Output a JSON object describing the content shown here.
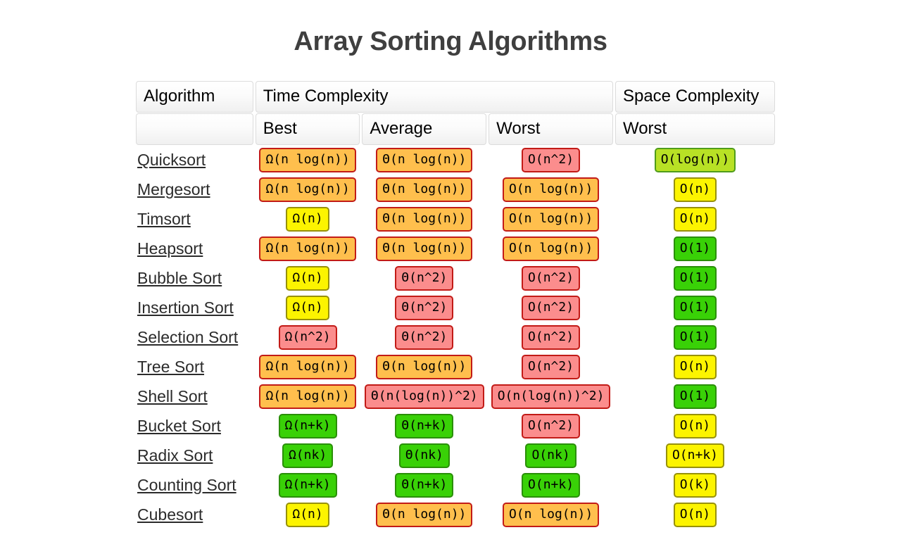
{
  "title": "Array Sorting Algorithms",
  "table": {
    "group_headers": [
      {
        "label": "Algorithm",
        "span": 1
      },
      {
        "label": "Time Complexity",
        "span": 3
      },
      {
        "label": "Space Complexity",
        "span": 1
      }
    ],
    "sub_headers": [
      "",
      "Best",
      "Average",
      "Worst",
      "Worst"
    ],
    "rows": [
      {
        "algorithm": "Quicksort",
        "best": {
          "text": "Ω(n log(n))",
          "rating": "bad"
        },
        "average": {
          "text": "Θ(n log(n))",
          "rating": "bad"
        },
        "worst": {
          "text": "O(n^2)",
          "rating": "horrible"
        },
        "space": {
          "text": "O(log(n))",
          "rating": "good"
        }
      },
      {
        "algorithm": "Mergesort",
        "best": {
          "text": "Ω(n log(n))",
          "rating": "bad"
        },
        "average": {
          "text": "Θ(n log(n))",
          "rating": "bad"
        },
        "worst": {
          "text": "O(n log(n))",
          "rating": "bad"
        },
        "space": {
          "text": "O(n)",
          "rating": "fair"
        }
      },
      {
        "algorithm": "Timsort",
        "best": {
          "text": "Ω(n)",
          "rating": "fair"
        },
        "average": {
          "text": "Θ(n log(n))",
          "rating": "bad"
        },
        "worst": {
          "text": "O(n log(n))",
          "rating": "bad"
        },
        "space": {
          "text": "O(n)",
          "rating": "fair"
        }
      },
      {
        "algorithm": "Heapsort",
        "best": {
          "text": "Ω(n log(n))",
          "rating": "bad"
        },
        "average": {
          "text": "Θ(n log(n))",
          "rating": "bad"
        },
        "worst": {
          "text": "O(n log(n))",
          "rating": "bad"
        },
        "space": {
          "text": "O(1)",
          "rating": "excellent"
        }
      },
      {
        "algorithm": "Bubble Sort",
        "best": {
          "text": "Ω(n)",
          "rating": "fair"
        },
        "average": {
          "text": "Θ(n^2)",
          "rating": "horrible"
        },
        "worst": {
          "text": "O(n^2)",
          "rating": "horrible"
        },
        "space": {
          "text": "O(1)",
          "rating": "excellent"
        }
      },
      {
        "algorithm": "Insertion Sort",
        "best": {
          "text": "Ω(n)",
          "rating": "fair"
        },
        "average": {
          "text": "Θ(n^2)",
          "rating": "horrible"
        },
        "worst": {
          "text": "O(n^2)",
          "rating": "horrible"
        },
        "space": {
          "text": "O(1)",
          "rating": "excellent"
        }
      },
      {
        "algorithm": "Selection Sort",
        "best": {
          "text": "Ω(n^2)",
          "rating": "horrible"
        },
        "average": {
          "text": "Θ(n^2)",
          "rating": "horrible"
        },
        "worst": {
          "text": "O(n^2)",
          "rating": "horrible"
        },
        "space": {
          "text": "O(1)",
          "rating": "excellent"
        }
      },
      {
        "algorithm": "Tree Sort",
        "best": {
          "text": "Ω(n log(n))",
          "rating": "bad"
        },
        "average": {
          "text": "Θ(n log(n))",
          "rating": "bad"
        },
        "worst": {
          "text": "O(n^2)",
          "rating": "horrible"
        },
        "space": {
          "text": "O(n)",
          "rating": "fair"
        }
      },
      {
        "algorithm": "Shell Sort",
        "best": {
          "text": "Ω(n log(n))",
          "rating": "bad"
        },
        "average": {
          "text": "Θ(n(log(n))^2)",
          "rating": "horrible"
        },
        "worst": {
          "text": "O(n(log(n))^2)",
          "rating": "horrible"
        },
        "space": {
          "text": "O(1)",
          "rating": "excellent"
        }
      },
      {
        "algorithm": "Bucket Sort",
        "best": {
          "text": "Ω(n+k)",
          "rating": "excellent"
        },
        "average": {
          "text": "Θ(n+k)",
          "rating": "excellent"
        },
        "worst": {
          "text": "O(n^2)",
          "rating": "horrible"
        },
        "space": {
          "text": "O(n)",
          "rating": "fair"
        }
      },
      {
        "algorithm": "Radix Sort",
        "best": {
          "text": "Ω(nk)",
          "rating": "excellent"
        },
        "average": {
          "text": "Θ(nk)",
          "rating": "excellent"
        },
        "worst": {
          "text": "O(nk)",
          "rating": "excellent"
        },
        "space": {
          "text": "O(n+k)",
          "rating": "fair"
        }
      },
      {
        "algorithm": "Counting Sort",
        "best": {
          "text": "Ω(n+k)",
          "rating": "excellent"
        },
        "average": {
          "text": "Θ(n+k)",
          "rating": "excellent"
        },
        "worst": {
          "text": "O(n+k)",
          "rating": "excellent"
        },
        "space": {
          "text": "O(k)",
          "rating": "fair"
        }
      },
      {
        "algorithm": "Cubesort",
        "best": {
          "text": "Ω(n)",
          "rating": "fair"
        },
        "average": {
          "text": "Θ(n log(n))",
          "rating": "bad"
        },
        "worst": {
          "text": "O(n log(n))",
          "rating": "bad"
        },
        "space": {
          "text": "O(n)",
          "rating": "fair"
        }
      }
    ]
  },
  "colors": {
    "excellent": "#39d107",
    "good": "#b8e125",
    "fair": "#fcf400",
    "bad": "#ffbf4d",
    "horrible": "#fb8d8d",
    "title": "#3f3f3f",
    "link": "#2b2b2b"
  }
}
